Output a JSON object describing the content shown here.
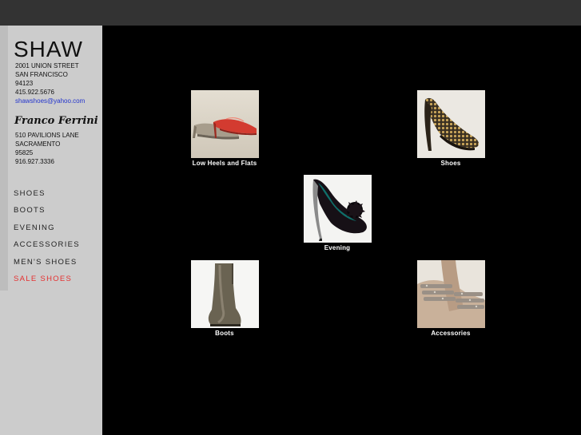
{
  "sidebar": {
    "brand": "SHAW",
    "store1": {
      "line1": "2001 UNION STREET",
      "line2": "SAN FRANCISCO",
      "line3": "94123",
      "phone": "415.922.5676",
      "email": "shawshoes@yahoo.com"
    },
    "store2_name": "Franco Ferrini",
    "store2": {
      "line1": "510 PAVILIONS LANE",
      "line2": "SACRAMENTO",
      "line3": "95825",
      "phone": "916.927.3336"
    },
    "nav": [
      {
        "label": "SHOES"
      },
      {
        "label": "BOOTS"
      },
      {
        "label": "EVENING"
      },
      {
        "label": "ACCESSORIES"
      },
      {
        "label": "MEN'S SHOES"
      },
      {
        "label": "SALE SHOES"
      }
    ]
  },
  "gallery": [
    {
      "caption": "Low Heels and Flats"
    },
    {
      "caption": "Shoes"
    },
    {
      "caption": "Evening"
    },
    {
      "caption": "Boots"
    },
    {
      "caption": "Accessories"
    }
  ],
  "colors": {
    "sale_accent": "#e53030",
    "link": "#2233cc",
    "sidebar_bg": "#cccccc",
    "topbar_bg": "#333333"
  }
}
